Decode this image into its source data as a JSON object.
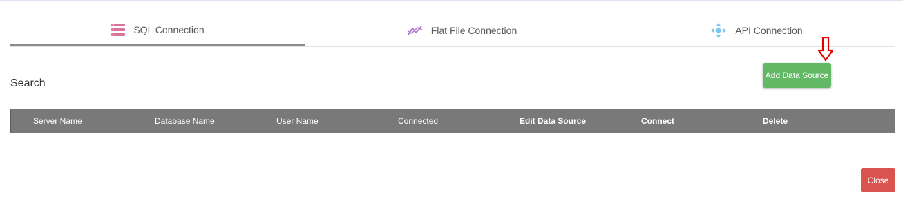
{
  "tabs": [
    {
      "label": "SQL Connection",
      "icon": "database-icon",
      "active": true
    },
    {
      "label": "Flat File Connection",
      "icon": "chart-line-icon",
      "active": false
    },
    {
      "label": "API Connection",
      "icon": "api-nodes-icon",
      "active": false
    }
  ],
  "search": {
    "label": "Search",
    "value": ""
  },
  "toolbar": {
    "add_label": "Add Data Source"
  },
  "grid": {
    "columns": [
      "Server Name",
      "Database Name",
      "User Name",
      "Connected",
      "Edit Data Source",
      "Connect",
      "Delete"
    ],
    "rows": []
  },
  "footer": {
    "close_label": "Close"
  },
  "colors": {
    "sql_icon": "#d9739a",
    "flat_icon": "#b07ad0",
    "api_icon": "#7cc6f0",
    "add_button": "#62b865",
    "close_button": "#d9534f",
    "grid_header": "#797979",
    "arrow": "#e00000"
  },
  "annotation": {
    "arrow_icon": "down-arrow-icon"
  }
}
